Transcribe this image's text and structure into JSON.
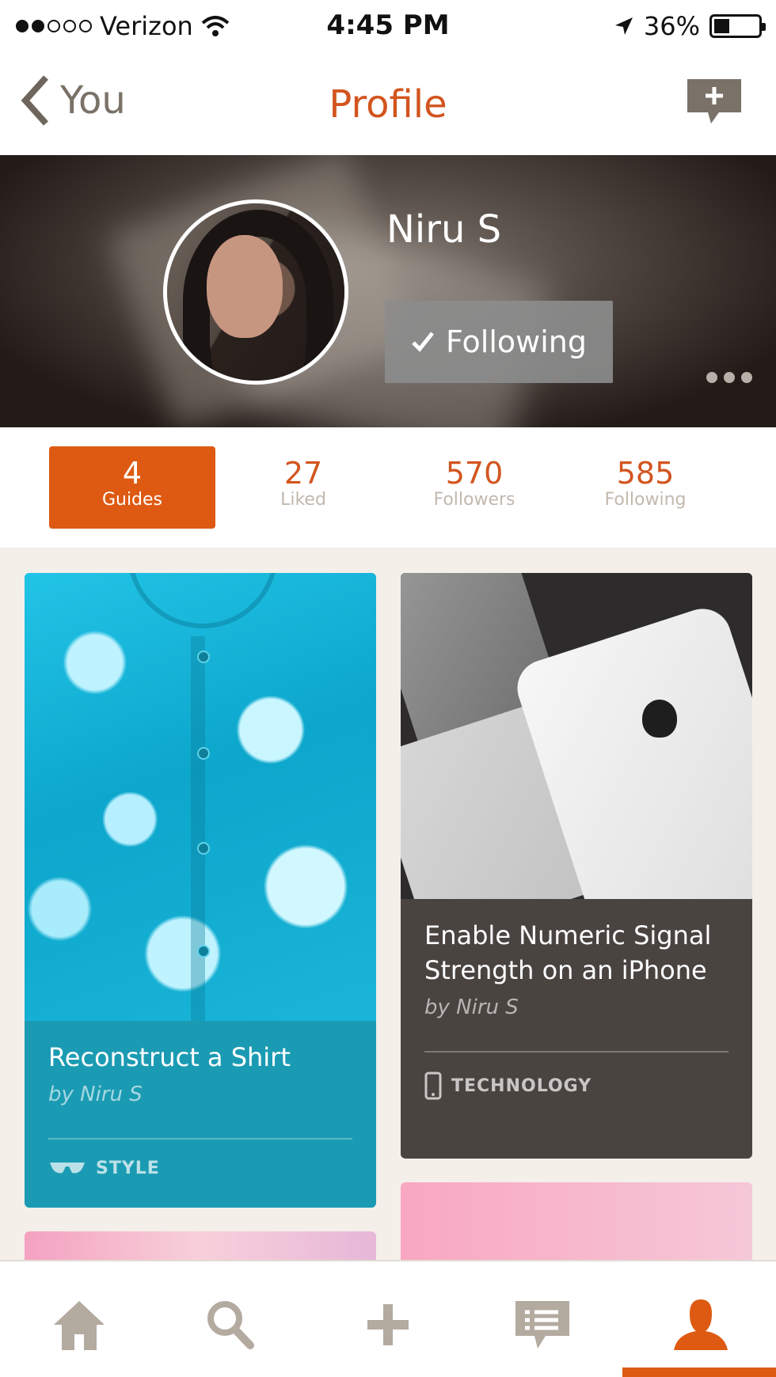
{
  "status_bar": {
    "carrier": "Verizon",
    "time": "4:45 PM",
    "battery": "36%",
    "battery_level": 0.36,
    "signal_bars": 2
  },
  "nav": {
    "back_label": "You",
    "title": "Profile"
  },
  "profile": {
    "name": "Niru S",
    "follow_label": "Following",
    "follow_icon": "check-icon"
  },
  "stats": [
    {
      "value": "4",
      "label": "Guides",
      "active": true
    },
    {
      "value": "27",
      "label": "Liked"
    },
    {
      "value": "570",
      "label": "Followers"
    },
    {
      "value": "585",
      "label": "Following"
    }
  ],
  "cards": [
    {
      "title": "Reconstruct a Shirt",
      "author": "by Niru S",
      "category": "STYLE",
      "category_icon": "sunglasses-icon"
    },
    {
      "title": "Enable Numeric Signal Strength on an iPhone",
      "author": "by Niru S",
      "category": "TECHNOLOGY",
      "category_icon": "phone-icon"
    }
  ],
  "tab_bar": {
    "items": [
      "home-icon",
      "search-icon",
      "plus-icon",
      "messages-icon",
      "profile-icon"
    ],
    "active": "profile-icon"
  },
  "colors": {
    "accent": "#de5a12",
    "title_orange": "#d2551f",
    "style_card": "#1b9bb3",
    "tech_card": "#4a4441"
  }
}
